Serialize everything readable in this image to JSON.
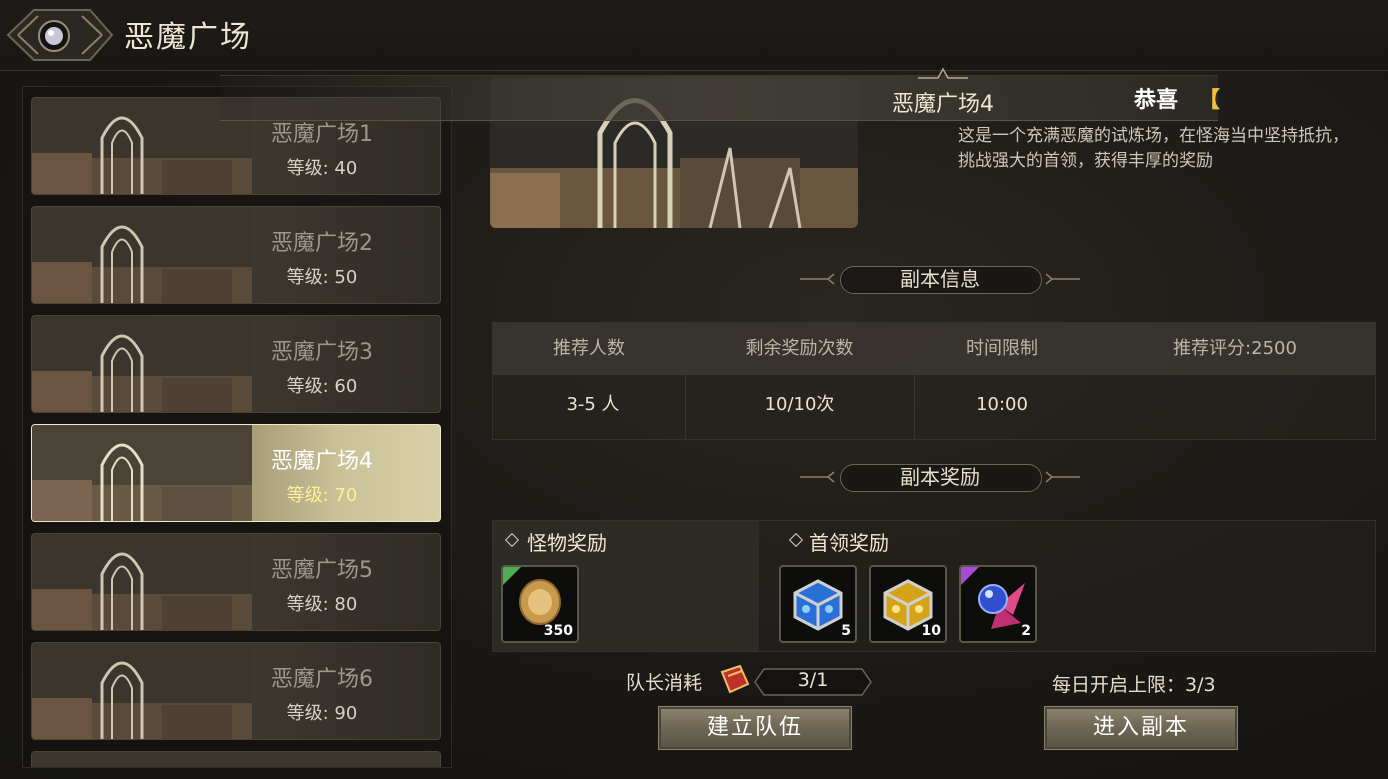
{
  "header": {
    "title": "恶魔广场"
  },
  "sidebar": {
    "items": [
      {
        "name": "恶魔广场1",
        "level": "等级: 40",
        "active": false
      },
      {
        "name": "恶魔广场2",
        "level": "等级: 50",
        "active": false
      },
      {
        "name": "恶魔广场3",
        "level": "等级: 60",
        "active": false
      },
      {
        "name": "恶魔广场4",
        "level": "等级: 70",
        "active": true
      },
      {
        "name": "恶魔广场5",
        "level": "等级: 80",
        "active": false
      },
      {
        "name": "恶魔广场6",
        "level": "等级: 90",
        "active": false
      }
    ]
  },
  "detail": {
    "title": "恶魔广场4",
    "congrats": "恭喜",
    "congrats_bracket": "【",
    "description": "这是一个充满恶魔的试炼场，在怪海当中坚持抵抗，挑战强大的首领，获得丰厚的奖励"
  },
  "info": {
    "section_title": "副本信息",
    "headers": [
      "推荐人数",
      "剩余奖励次数",
      "时间限制",
      "推荐评分:2500"
    ],
    "values": [
      "3-5 人",
      "10/10次",
      "10:00",
      ""
    ]
  },
  "rewards": {
    "section_title": "副本奖励",
    "monster_title": "怪物奖励",
    "boss_title": "首领奖励",
    "monster_items": [
      {
        "icon": "gold-coin-icon",
        "count": "350",
        "rarity_color": "#4caf50"
      }
    ],
    "boss_items": [
      {
        "icon": "blue-gem-chest-icon",
        "count": "5",
        "rarity_color": ""
      },
      {
        "icon": "gold-gem-chest-icon",
        "count": "10",
        "rarity_color": ""
      },
      {
        "icon": "crystal-orb-icon",
        "count": "2",
        "rarity_color": "#a64bd6"
      }
    ]
  },
  "footer": {
    "leader_cost_label": "队长消耗",
    "leader_cost_value": "3/1",
    "daily_limit": "每日开启上限：3/3",
    "create_team": "建立队伍",
    "enter_dungeon": "进入副本"
  }
}
